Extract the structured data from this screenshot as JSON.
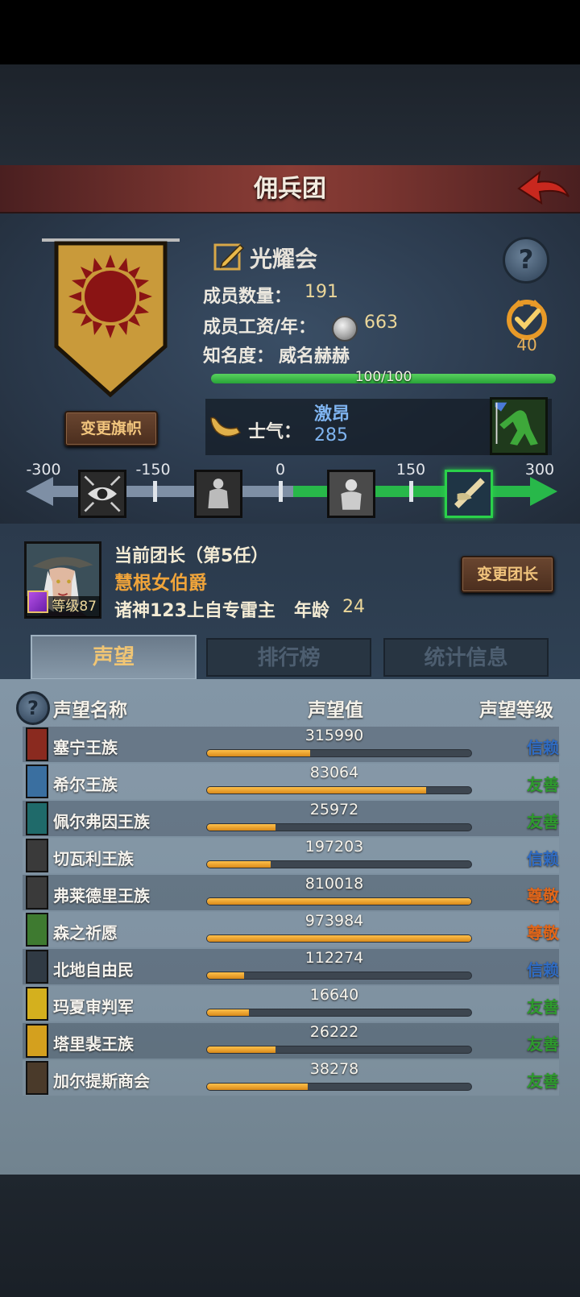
{
  "header": {
    "title": "佣兵团"
  },
  "guild": {
    "name": "光耀会",
    "members_label": "成员数量：",
    "members_value": "191",
    "salary_label": "成员工资/年：",
    "salary_value": "663",
    "fame_label": "知名度：",
    "fame_title": "威名赫赫",
    "fame_progress": "100/100",
    "fame_fraction": 1.0,
    "medal_value": "40",
    "change_banner_label": "变更旗帜"
  },
  "morale": {
    "label": "士气：",
    "state": "激昂",
    "value": "285",
    "scale_ticks": [
      "-300",
      "-150",
      "0",
      "150",
      "300"
    ]
  },
  "leader": {
    "title": "当前团长（第5任）",
    "name": "慧根女伯爵",
    "level": "等级87",
    "info": "诸神123上自专雷主",
    "age_label": "年龄",
    "age_value": "24",
    "change_label": "变更团长"
  },
  "tabs": [
    {
      "label": "声望",
      "active": true
    },
    {
      "label": "排行榜",
      "active": false
    },
    {
      "label": "统计信息",
      "active": false
    }
  ],
  "table": {
    "headers": {
      "name": "声望名称",
      "value": "声望值",
      "level": "声望等级"
    },
    "rows": [
      {
        "name": "塞宁王族",
        "value": "315990",
        "fill": 0.39,
        "level": "信赖",
        "color": "#2f6bc2",
        "crest": "#8a2a1f"
      },
      {
        "name": "希尔王族",
        "value": "83064",
        "fill": 0.83,
        "level": "友善",
        "color": "#2e9a2e",
        "crest": "#3a6fa0"
      },
      {
        "name": "佩尔弗因王族",
        "value": "25972",
        "fill": 0.26,
        "level": "友善",
        "color": "#2e9a2e",
        "crest": "#1f6a6a"
      },
      {
        "name": "切瓦利王族",
        "value": "197203",
        "fill": 0.24,
        "level": "信赖",
        "color": "#2f6bc2",
        "crest": "#3a3a3a"
      },
      {
        "name": "弗莱德里王族",
        "value": "810018",
        "fill": 1.0,
        "level": "尊敬",
        "color": "#e0661a",
        "crest": "#3a3a3a"
      },
      {
        "name": "森之祈愿",
        "value": "973984",
        "fill": 1.0,
        "level": "尊敬",
        "color": "#e0661a",
        "crest": "#3e7a30"
      },
      {
        "name": "北地自由民",
        "value": "112274",
        "fill": 0.14,
        "level": "信赖",
        "color": "#2f6bc2",
        "crest": "#303a44"
      },
      {
        "name": "玛夏审判军",
        "value": "16640",
        "fill": 0.16,
        "level": "友善",
        "color": "#2e9a2e",
        "crest": "#d4b01e"
      },
      {
        "name": "塔里裴王族",
        "value": "26222",
        "fill": 0.26,
        "level": "友善",
        "color": "#2e9a2e",
        "crest": "#d4a01e"
      },
      {
        "name": "加尔提斯商会",
        "value": "38278",
        "fill": 0.38,
        "level": "友善",
        "color": "#2e9a2e",
        "crest": "#4a3a2a"
      }
    ]
  }
}
